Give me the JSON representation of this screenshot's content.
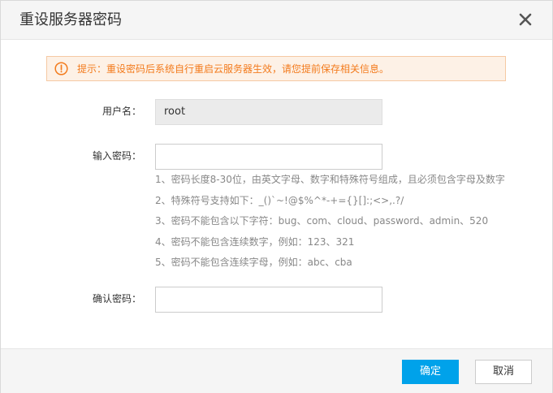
{
  "dialog": {
    "title": "重设服务器密码",
    "close_icon": "close-icon"
  },
  "tip": {
    "icon": "warning-circle-icon",
    "text": "提示：重设密码后系统自行重启云服务器生效，请您提前保存相关信息。",
    "color": "#f37b1d",
    "background": "#fdf1e6"
  },
  "form": {
    "username_label": "用户名：",
    "username_value": "root",
    "password_label": "输入密码：",
    "password_value": "",
    "confirm_label": "确认密码：",
    "confirm_value": ""
  },
  "rules": [
    "1、密码长度8-30位，由英文字母、数字和特殊符号组成，且必须包含字母及数字",
    "2、特殊符号支持如下：_()`~!@$%^*-+={}[]:;<>,.?/",
    "3、密码不能包含以下字符：bug、com、cloud、password、admin、520",
    "4、密码不能包含连续数字，例如：123、321",
    "5、密码不能包含连续字母，例如：abc、cba"
  ],
  "footer": {
    "confirm_label": "确定",
    "cancel_label": "取消",
    "primary_color": "#00a2ea"
  }
}
